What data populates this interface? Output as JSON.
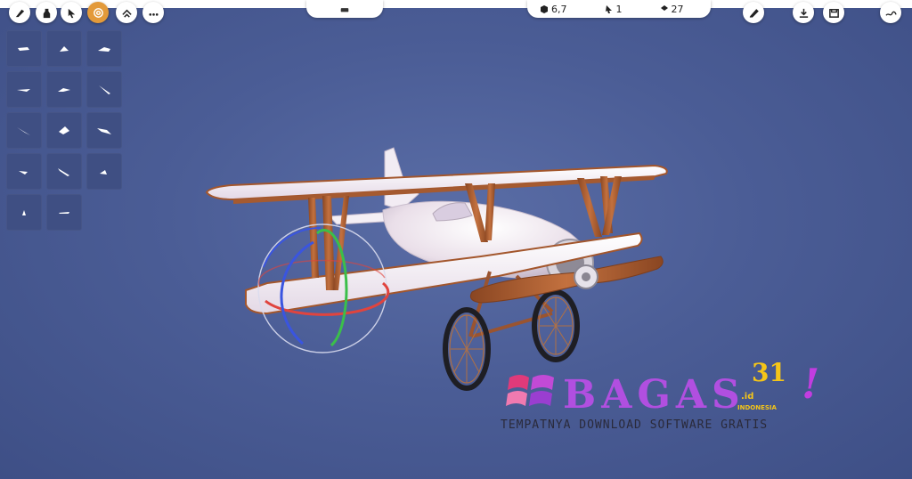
{
  "toolbar_left": {
    "buttons": [
      {
        "icon": "brush-icon",
        "active": false
      },
      {
        "icon": "bottle-icon",
        "active": false
      },
      {
        "icon": "pointer-icon",
        "active": false
      },
      {
        "icon": "spiral-icon",
        "active": true
      },
      {
        "icon": "layers-icon",
        "active": false
      },
      {
        "icon": "more-icon",
        "active": false
      }
    ]
  },
  "center_pill": {
    "icon": "mode-icon"
  },
  "stats": {
    "vertices": "6,7",
    "objects": "1",
    "layers": "27"
  },
  "toolbar_right": {
    "buttons": [
      {
        "icon": "pen-icon"
      },
      {
        "icon": "export-icon"
      },
      {
        "icon": "save-icon"
      },
      {
        "icon": "signature-icon"
      }
    ]
  },
  "brush_palette": {
    "count": 14,
    "items": [
      "stroke-1",
      "stroke-2",
      "stroke-3",
      "stroke-4",
      "stroke-5",
      "stroke-6",
      "stroke-7",
      "stroke-8",
      "stroke-9",
      "stroke-10",
      "stroke-11",
      "stroke-12",
      "stroke-13",
      "stroke-14"
    ]
  },
  "scene": {
    "subject": "biplane-model",
    "gizmo": "rotate-gizmo",
    "colors": {
      "fuselage": "#f4eff4",
      "wood": "#b5663a",
      "background": "#4b5d96",
      "gizmo_red": "#e0443e",
      "gizmo_green": "#3bbf4a",
      "gizmo_blue": "#3a55e0"
    }
  },
  "watermark": {
    "brand": "BAGAS",
    "number": "31",
    "suffix": ".id",
    "country": "INDONESIA",
    "exclaim": "!",
    "tagline": "TEMPATNYA DOWNLOAD SOFTWARE GRATIS"
  }
}
